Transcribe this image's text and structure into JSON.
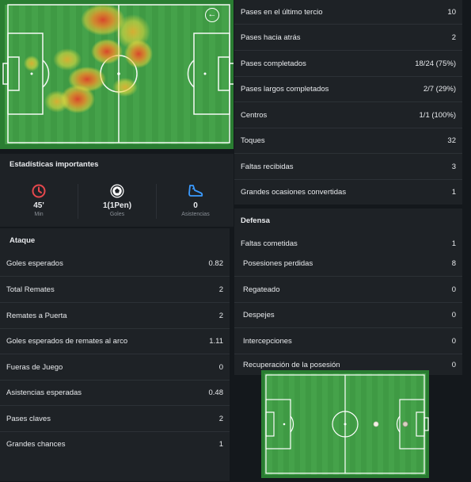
{
  "heatmap": {
    "back_label": "←"
  },
  "key_stats": {
    "title": "Estadísticas importantes",
    "items": [
      {
        "icon": "clock-icon",
        "value": "45'",
        "label": "Min",
        "color": "#e5484d"
      },
      {
        "icon": "soccer-ball-icon",
        "value": "1(1Pen)",
        "label": "Goles",
        "color": "#ffffff"
      },
      {
        "icon": "boot-icon",
        "value": "0",
        "label": "Asistencias",
        "color": "#3b9bff"
      }
    ]
  },
  "attack": {
    "title": "Ataque",
    "rows": [
      {
        "label": "Goles esperados",
        "value": "0.82"
      },
      {
        "label": "Total Remates",
        "value": "2"
      },
      {
        "label": "Remates a Puerta",
        "value": "2"
      },
      {
        "label": "Goles esperados de remates al arco",
        "value": "1.11"
      },
      {
        "label": "Fueras de Juego",
        "value": "0"
      },
      {
        "label": "Asistencias esperadas",
        "value": "0.48"
      },
      {
        "label": "Pases claves",
        "value": "2"
      },
      {
        "label": "Grandes chances",
        "value": "1"
      }
    ]
  },
  "passing": {
    "rows": [
      {
        "label": "Pases en el último tercio",
        "value": "10"
      },
      {
        "label": "Pases hacia atrás",
        "value": "2"
      },
      {
        "label": "Pases completados",
        "value": "18/24 (75%)"
      },
      {
        "label": "Pases largos completados",
        "value": "2/7 (29%)"
      },
      {
        "label": "Centros",
        "value": "1/1 (100%)"
      },
      {
        "label": "Toques",
        "value": "32"
      },
      {
        "label": "Faltas recibidas",
        "value": "3"
      },
      {
        "label": "Grandes ocasiones convertidas",
        "value": "1"
      }
    ]
  },
  "defense": {
    "title": "Defensa",
    "rows": [
      {
        "label": "Faltas cometidas",
        "value": "1"
      },
      {
        "label": "Posesiones perdidas",
        "value": "8"
      },
      {
        "label": "Regateado",
        "value": "0"
      },
      {
        "label": "Despejes",
        "value": "0"
      },
      {
        "label": "Intercepciones",
        "value": "0"
      },
      {
        "label": "Recuperación de la posesión",
        "value": "0"
      }
    ]
  }
}
